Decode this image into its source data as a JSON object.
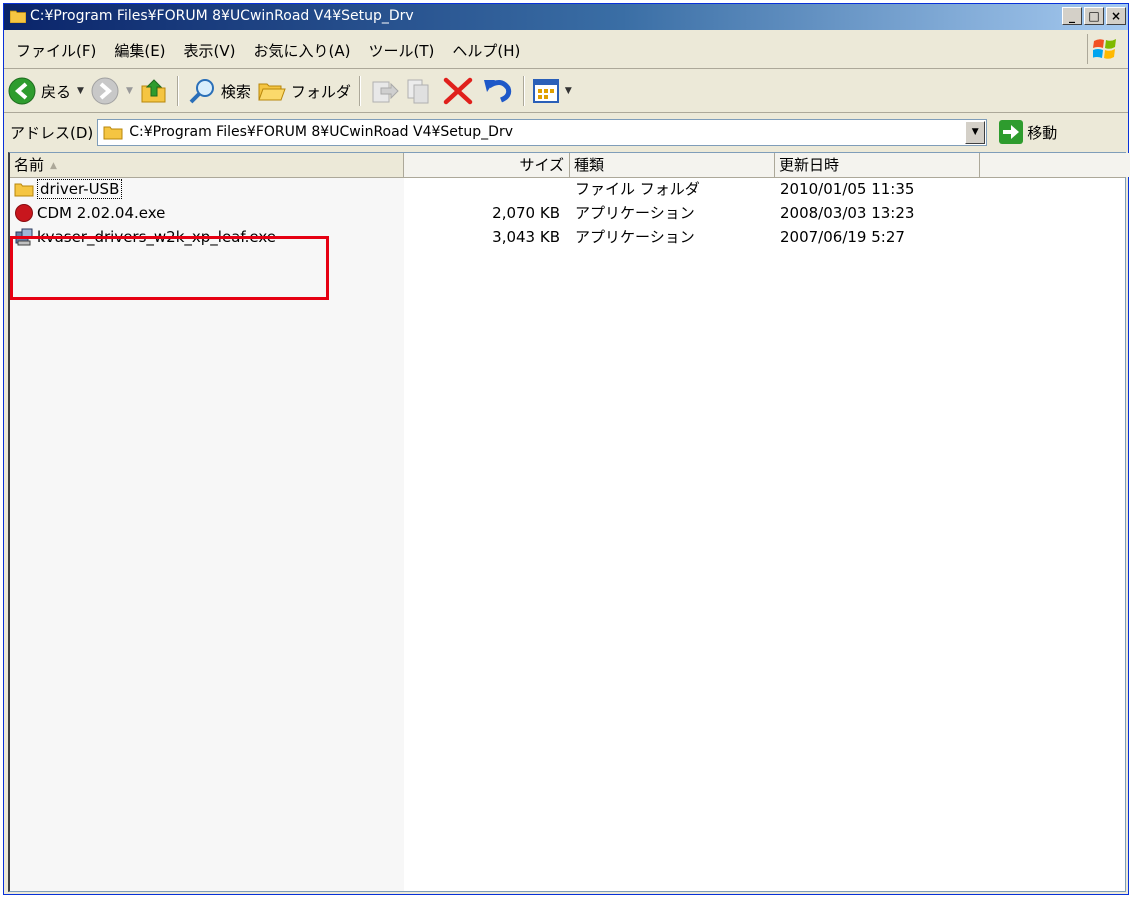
{
  "window": {
    "title": "C:¥Program Files¥FORUM 8¥UCwinRoad V4¥Setup_Drv",
    "controls": [
      "_",
      "□",
      "×"
    ]
  },
  "menubar": {
    "items": [
      "ファイル(F)",
      "編集(E)",
      "表示(V)",
      "お気に入り(A)",
      "ツール(T)",
      "ヘルプ(H)"
    ]
  },
  "toolbar": {
    "back_label": "戻る",
    "search_label": "検索",
    "folders_label": "フォルダ"
  },
  "address": {
    "label": "アドレス(D)",
    "value": "C:¥Program Files¥FORUM 8¥UCwinRoad V4¥Setup_Drv",
    "go_label": "移動"
  },
  "list": {
    "columns": {
      "name": "名前",
      "size": "サイズ",
      "type": "種類",
      "modified": "更新日時"
    },
    "rows": [
      {
        "name": "driver-USB",
        "size": "",
        "type": "ファイル フォルダ",
        "modified": "2010/01/05 11:35",
        "icon": "folder-icon"
      },
      {
        "name": "CDM 2.02.04.exe",
        "size": "2,070 KB",
        "type": "アプリケーション",
        "modified": "2008/03/03 13:23",
        "icon": "red-circle-app-icon"
      },
      {
        "name": "kvaser_drivers_w2k_xp_leaf.exe",
        "size": "3,043 KB",
        "type": "アプリケーション",
        "modified": "2007/06/19 5:27",
        "icon": "installer-app-icon"
      }
    ]
  },
  "colors": {
    "highlight": "#e60012",
    "titlebar": "#0a246a"
  }
}
